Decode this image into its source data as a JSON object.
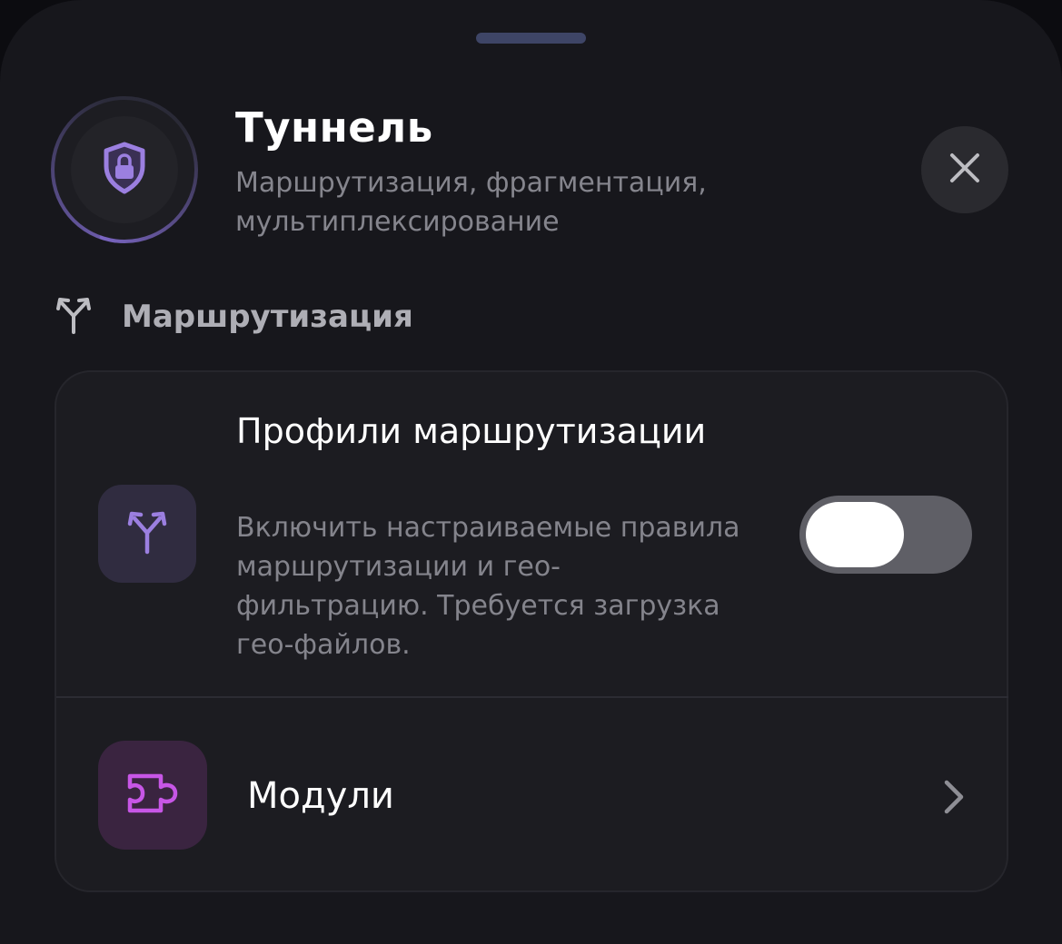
{
  "header": {
    "title": "Туннель",
    "subtitle": "Маршрутизация, фрагментация, мультиплексирование",
    "hero_icon": "shield-lock-icon",
    "close_icon": "close-icon"
  },
  "section": {
    "label": "Маршрутизация",
    "icon": "route-split-icon"
  },
  "rows": {
    "profiles": {
      "title": "Профили маршрутизации",
      "description": "Включить настраиваемые правила маршрутизации и гео-фильтрацию. Требуется загрузка гео-файлов.",
      "icon": "route-split-icon",
      "toggle_on": false
    },
    "modules": {
      "label": "Модули",
      "icon": "puzzle-icon",
      "chevron": "chevron-right-icon"
    }
  },
  "colors": {
    "accent_purple": "#9b7fe0",
    "modules_magenta": "#c756e6",
    "background": "#17171c"
  }
}
